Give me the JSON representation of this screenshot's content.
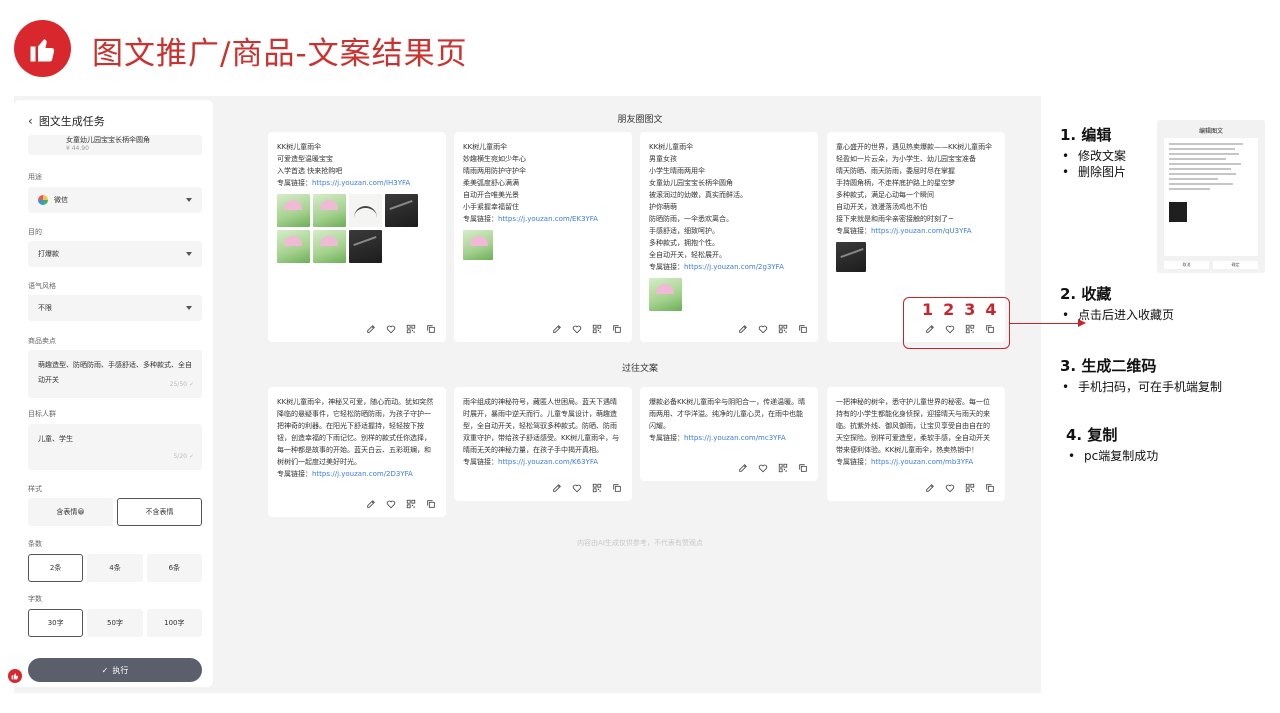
{
  "header": {
    "title": "图文推广/商品-文案结果页"
  },
  "left": {
    "title": "图文生成任务",
    "product": {
      "name": "女童幼儿园宝宝长柄伞圆角",
      "price": "¥ 44.90"
    },
    "usage_label": "用途",
    "usage_value": "微信",
    "purpose_label": "目的",
    "purpose_value": "打爆款",
    "tone_label": "语气风格",
    "tone_value": "不限",
    "selling_label": "商品卖点",
    "selling_value": "萌趣造型、防晒防雨、手感舒适、多种款式、全自动开关",
    "selling_count": "25/50",
    "audience_label": "目标人群",
    "audience_value": "儿童、学生",
    "audience_count": "5/20",
    "style_label": "样式",
    "style_options": [
      "含表情😀",
      "不含表情"
    ],
    "count_label": "条数",
    "count_options": [
      "2条",
      "4条",
      "6条"
    ],
    "words_label": "字数",
    "words_options": [
      "30字",
      "50字",
      "100字"
    ],
    "execute": "执行"
  },
  "main": {
    "moments_title": "朋友圈图文",
    "past_title": "过往文案",
    "footnote": "内容由AI生成仅供参考，不代表有赞观点",
    "cards": [
      {
        "lines": [
          "KK树儿童雨伞",
          "可爱造型温暖宝宝",
          "入学首选 快来抢购吧"
        ],
        "link_prefix": "专属链接：",
        "link": "https://j.youzan.com/lH3YFA"
      },
      {
        "lines": [
          "KK树儿童雨伞",
          "妙趣横生宛如少年心",
          "晴雨两用防护守护伞",
          "柔美弧度舒心满满",
          "自动开合唯美光景",
          "小手紧握幸福留住"
        ],
        "link_prefix": "专属链接：",
        "link": "https://j.youzan.com/EK3YFA"
      },
      {
        "lines": [
          "KK树儿童雨伞",
          "男童女孩",
          "小学生晴雨两用伞",
          "女童幼儿园宝宝长柄伞圆角",
          "被滚润过的幼嫩，真实而鲜活。",
          "护你萌萌",
          "防晒防雨，一伞悉欢离合。",
          "手感舒适，细致呵护。",
          "多种款式，拥抱个性。",
          "全自动开关，轻松展开。"
        ],
        "link_prefix": "专属链接：",
        "link": "https://j.youzan.com/2g3YFA"
      },
      {
        "lines": [
          "童心盛开的世界，遇见热卖爆款——KK树儿童雨伞",
          "轻盈如一片云朵，为小学生、幼儿园宝宝准备",
          "晴天防晒、雨天防雨，委屈时尽在掌握",
          "手持圆角柄，不走样底护路上的星空梦",
          "多种款式，满足心动每一个瞬间",
          "自动开关，浪漫落汤鸡也不怕",
          "接下来就是和雨伞亲密接触的时刻了~"
        ],
        "link_prefix": "专属链接：",
        "link": "https://j.youzan.com/qU3YFA"
      }
    ],
    "past": [
      {
        "text": "KK树儿童雨伞，神秘又可爱，随心而动。犹如突然降临的悬疑事件，它轻松防晒防雨，为孩子守护一把神奇的利器。在阳光下舒适握持，轻轻按下按钮，创造幸福的下雨记忆。别样的款式任你选择，每一种都是故事的开始。蓝天白云、五彩斑斓，和树树们一起度过美好时光。",
        "link_prefix": "专属链接：",
        "link": "https://j.youzan.com/2D3YFA"
      },
      {
        "text": "雨伞组成的神秘符号，藏匿人世困局。蓝天下遇晴时展开，暴雨中逆天而行。儿童专属设计，萌趣造型，全自动开关，轻松驾驭多种款式。防晒、防雨双重守护，带给孩子舒适感受。KK树儿童雨伞，与晴雨无关的神秘力量，在孩子手中揭开真相。",
        "link_prefix": "专属链接：",
        "link": "https://j.youzan.com/K63YFA"
      },
      {
        "text": "爆款必备KK树儿童雨伞与阴阳合一，传递温暖。晴雨两用、才华洋溢。纯净的儿童心灵，在雨中也能闪耀。",
        "link_prefix": "专属链接：",
        "link": "https://j.youzan.com/mc3YFA"
      },
      {
        "text": "一把神秘的树伞，悉守护儿童世界的秘密。每一位持有的小学生都能化身侦探，迎接晴天与雨天的来临。抗紫外线、御风御雨，让宝贝享受自由自在的天空探险。别样可爱造型，柔软手感，全自动开关带来便利体验。KK树儿童雨伞，热卖热销中！",
        "link_prefix": "专属链接：",
        "link": "https://j.youzan.com/mb3YFA"
      }
    ]
  },
  "annotations": {
    "numbers": [
      "1",
      "2",
      "3",
      "4"
    ],
    "items": [
      {
        "title": "1.  编辑",
        "bullets": [
          "修改文案",
          "删除图片"
        ]
      },
      {
        "title": "2.  收藏",
        "bullets": [
          "点击后进入收藏页"
        ]
      },
      {
        "title": "3.  生成二维码",
        "bullets": [
          "手机扫码，可在手机端复制"
        ]
      },
      {
        "title": "4.  复制",
        "bullets": [
          "pc端复制成功"
        ]
      }
    ]
  },
  "preview": {
    "title": "编辑图文",
    "cancel": "取消",
    "confirm": "确定"
  },
  "colors": {
    "accent": "#c8242c",
    "link": "#3d7be3",
    "button": "#5a5f6b"
  }
}
